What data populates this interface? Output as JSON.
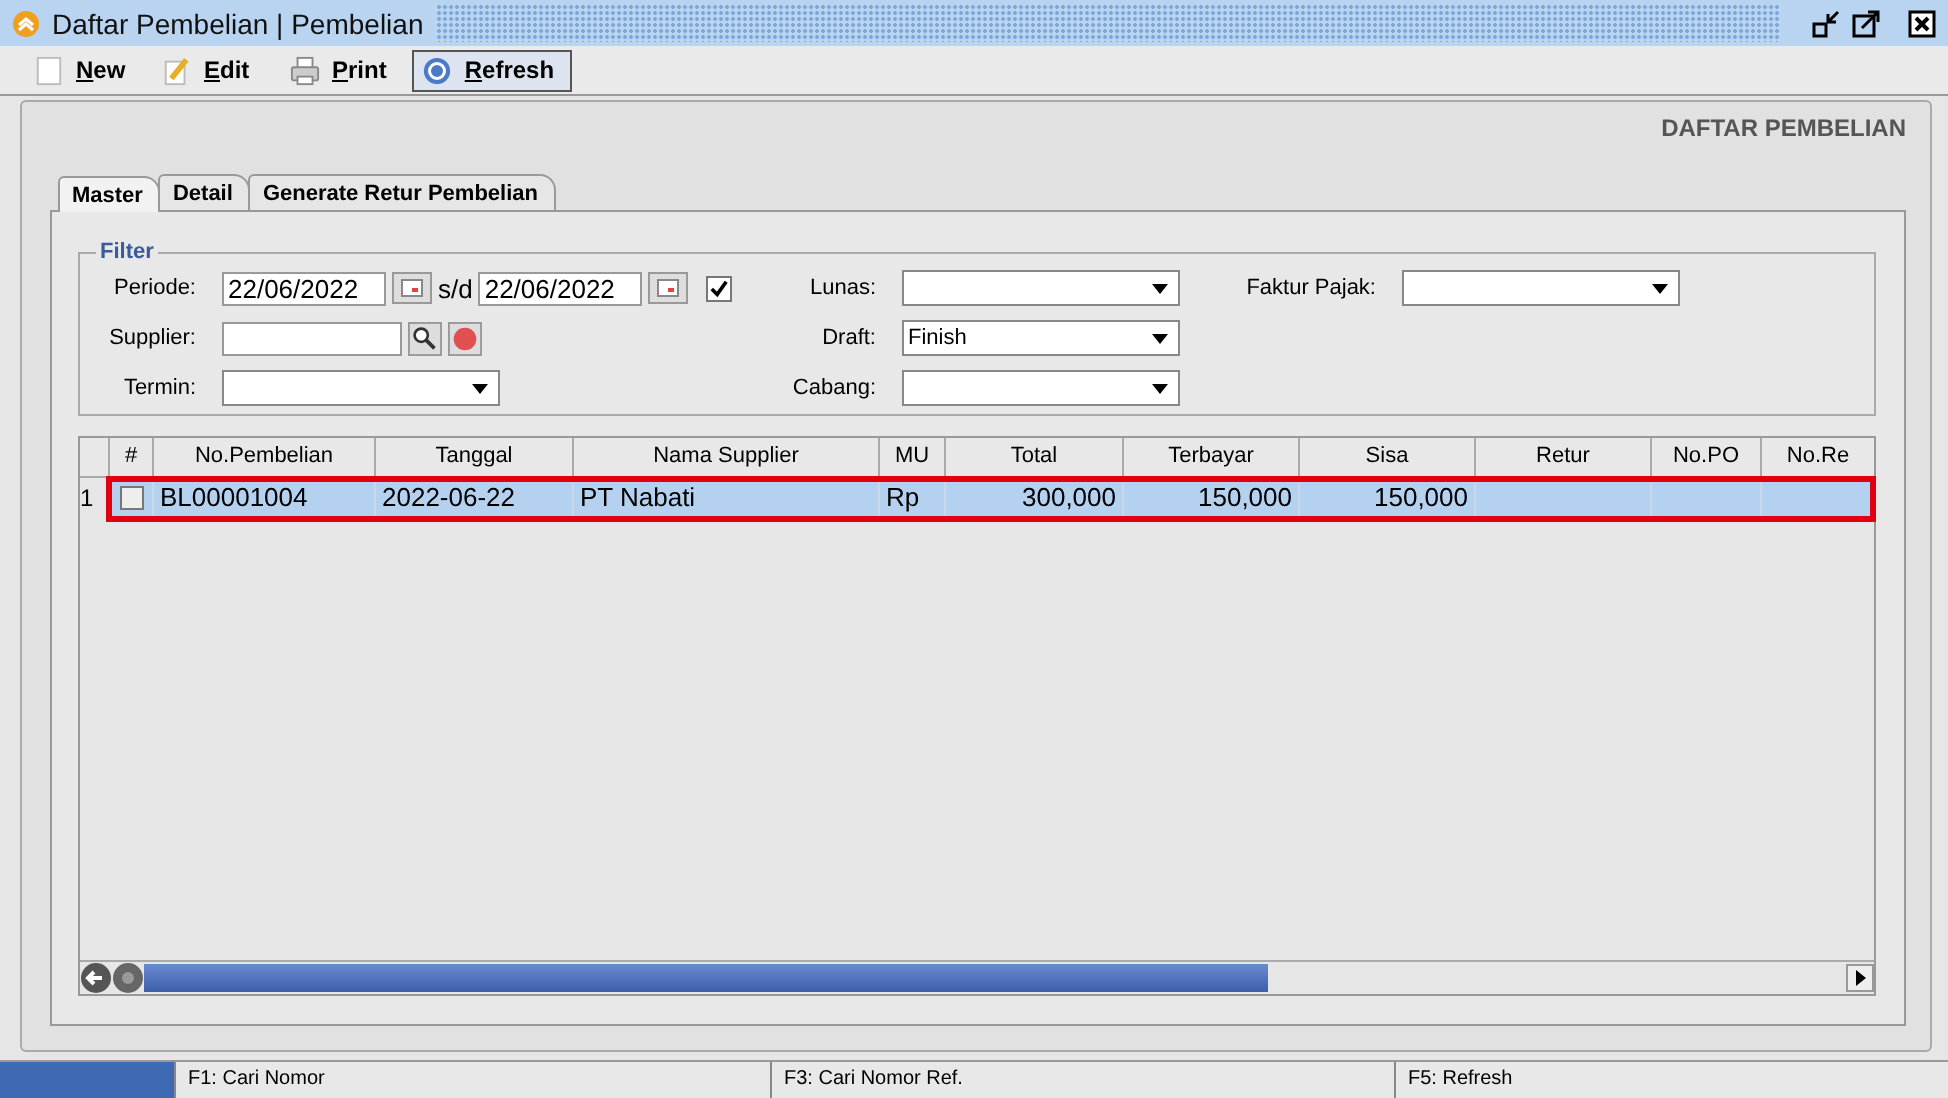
{
  "window": {
    "title": "Daftar Pembelian | Pembelian"
  },
  "toolbar": [
    {
      "label": "New",
      "selected": false
    },
    {
      "label": "Edit",
      "selected": false
    },
    {
      "label": "Print",
      "selected": false
    },
    {
      "label": "Refresh",
      "selected": true
    }
  ],
  "page_title": "DAFTAR PEMBELIAN",
  "tabs": [
    {
      "label": "Master",
      "selected": true
    },
    {
      "label": "Detail",
      "selected": false
    },
    {
      "label": "Generate Retur Pembelian",
      "selected": false
    }
  ],
  "filter": {
    "legend": "Filter",
    "periode": {
      "label": "Periode:",
      "from": "22/06/2022",
      "separator": "s/d",
      "to": "22/06/2022",
      "checked": true
    },
    "supplier": {
      "label": "Supplier:"
    },
    "termin": {
      "label": "Termin:"
    },
    "lunas": {
      "label": "Lunas:"
    },
    "draft": {
      "label": "Draft:",
      "value": "Finish"
    },
    "cabang": {
      "label": "Cabang:"
    },
    "faktur_pajak": {
      "label": "Faktur Pajak:"
    }
  },
  "table": {
    "columns": [
      "#",
      "No.Pembelian",
      "Tanggal",
      "Nama Supplier",
      "MU",
      "Total",
      "Terbayar",
      "Sisa",
      "Retur",
      "No.PO",
      "No.Re"
    ],
    "rows": [
      {
        "number": "1",
        "checked": false,
        "selected": true,
        "highlighted": true,
        "cells": [
          "",
          "BL00001004",
          "2022-06-22",
          "PT Nabati",
          "Rp",
          "300,000",
          "150,000",
          "150,000",
          "",
          "",
          ""
        ]
      }
    ]
  },
  "status_bar": [
    "F1: Cari Nomor",
    "F3: Cari Nomor Ref.",
    "F5: Refresh"
  ]
}
